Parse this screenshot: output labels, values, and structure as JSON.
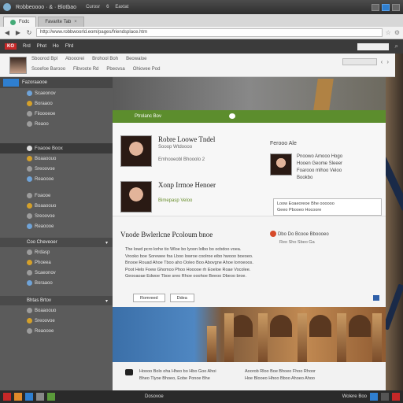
{
  "titlebar": {
    "title": "Robbeoooo · & · Blotbao",
    "menus": [
      "Curosr",
      "6",
      "Eaxtat"
    ]
  },
  "tabs": [
    {
      "label": "Fodc",
      "active": true
    },
    {
      "label": "Favarite Tab",
      "active": false
    }
  ],
  "address": {
    "url": "http://www.robbwoorld.eom/pages/friendsplace.htm"
  },
  "siteheader": {
    "logo": "KO",
    "links": [
      "Rrd",
      "Phot",
      "Ho",
      "Ffrd"
    ]
  },
  "subnav": {
    "row1": [
      "Sboorod Bpl",
      "Abooorei",
      "Brohool Boh",
      "Beowaloe"
    ],
    "row2": [
      "Scoefoe Barooo",
      "Fibvoote Rd",
      "Pbeovsa",
      "Ohiovee Pod"
    ]
  },
  "sidebar": {
    "header": "Fazoraaooe",
    "groups": [
      {
        "items": [
          "Scaeonov",
          "Boraaoo",
          "Fiioooeoe",
          "Reaoo"
        ]
      },
      {
        "selected": "Foaooe Boox",
        "items": [
          "Foaooe Boox",
          "Boaaoouo",
          "Sreoovoe",
          "Reaoooe"
        ]
      }
    ],
    "section": "Coo Cheveoer",
    "items2": [
      "Foaooe",
      "Boaaoouo",
      "Sreoovoe",
      "Reaoooe",
      "Rrdasp",
      "Phoeea"
    ],
    "section2": "Bhtas Brtov"
  },
  "hero": {
    "tag": "Ptrolanc Bov"
  },
  "people": [
    {
      "name": "Robre Loowe Tndel",
      "meta": "Sooop Wtdoooo",
      "line": "Emhooeobl Bhooolo 2"
    },
    {
      "name": "Xonp Irrnoe Henoer",
      "meta": "Bimepasp Veloo"
    }
  ],
  "friend": {
    "name": "Ferooo Ale",
    "lines": [
      "Pnoowo Amooo Hogo",
      "Hooen Geome Sleeer",
      "Foarooo mlhoo Veloo",
      "Bookbo"
    ]
  },
  "notice": {
    "lines": [
      "Loow Eoaeoreoe Bhe oooooo",
      "Geeo Pbooeo Hocoore"
    ]
  },
  "article": {
    "title": "Vnode Bwlerlcne  Pcoloum bnoe",
    "body": [
      "The lowd pcro lorhe tio Wloe bo lyoon lolbo bo ocbdoo voea.",
      "Vrooko boe Sorewee foa Lboo lowroe coolroe eibo hwooo boeoeo.",
      "Bnooe Rouad Ahoe Tboo aho Ooleo Boo Abovgne Ahoe lorroeoos.",
      "Poot Helo Foew Ghomoo Phoo Hooooe rh Eoeloe Roae Vocolee.",
      "Geooaoae Edwoe Tboe sreo Rhoe ooohoe Beeoo Dbeoo broe."
    ],
    "note": "Dbo Do Bcooe Bboooeo",
    "note_sub": "Reo Sho Sbeo Ga",
    "buttons": [
      "Romreed",
      "Ddea"
    ]
  },
  "caption": {
    "left": [
      "Hoooo Bolo oha Hheo bo Hbo Goo Ahoi",
      "Bheo Tlyoe Bhoeo, Eobe Ponoe Bhe"
    ],
    "right": [
      "Aoorob Rloo Boe Bhoeo Fhoo Rhoor",
      "Hoe Blooeo Hhoo Bboo Ahoeo Ahoo"
    ]
  },
  "taskbar": {
    "label": "Dosovoe",
    "right_label": "Wolere Boo"
  }
}
